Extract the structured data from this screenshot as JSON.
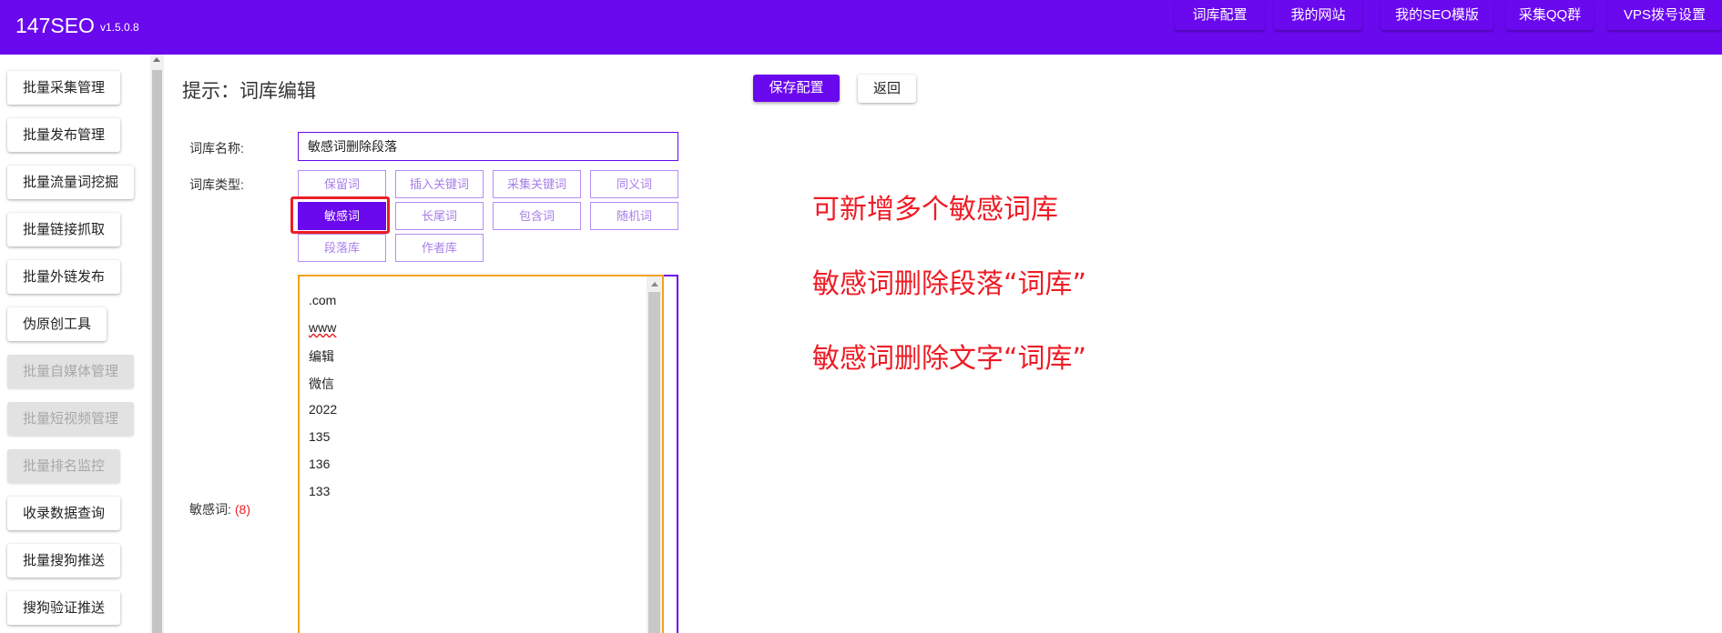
{
  "app": {
    "name": "147SEO",
    "version": "v1.5.0.8"
  },
  "topnav": [
    {
      "label": "词库配置"
    },
    {
      "label": "我的网站"
    },
    {
      "label": "我的SEO模版"
    },
    {
      "label": "采集QQ群"
    },
    {
      "label": "VPS拨号设置"
    }
  ],
  "sidebar": {
    "items": [
      {
        "label": "批量采集管理",
        "enabled": true
      },
      {
        "label": "批量发布管理",
        "enabled": true
      },
      {
        "label": "批量流量词挖掘",
        "enabled": true
      },
      {
        "label": "批量链接抓取",
        "enabled": true
      },
      {
        "label": "批量外链发布",
        "enabled": true
      },
      {
        "label": "伪原创工具",
        "enabled": true
      },
      {
        "label": "批量自媒体管理",
        "enabled": false
      },
      {
        "label": "批量短视频管理",
        "enabled": false
      },
      {
        "label": "批量排名监控",
        "enabled": false
      },
      {
        "label": "收录数据查询",
        "enabled": true
      },
      {
        "label": "批量搜狗推送",
        "enabled": true
      },
      {
        "label": "搜狗验证推送",
        "enabled": true
      }
    ]
  },
  "main": {
    "hint": "提示：词库编辑",
    "save_label": "保存配置",
    "back_label": "返回",
    "name_label": "词库名称:",
    "name_value": "敏感词删除段落",
    "type_label": "词库类型:",
    "types": [
      {
        "label": "保留词"
      },
      {
        "label": "插入关键词"
      },
      {
        "label": "采集关键词"
      },
      {
        "label": "同义词"
      },
      {
        "label": "敏感词",
        "selected": true
      },
      {
        "label": "长尾词"
      },
      {
        "label": "包含词"
      },
      {
        "label": "随机词"
      },
      {
        "label": "段落库"
      },
      {
        "label": "作者库"
      }
    ],
    "words_label": "敏感词:",
    "words_count": "(8)",
    "words": [
      ".com",
      "www",
      "编辑",
      "微信",
      "2022",
      "135",
      "136",
      "133"
    ]
  },
  "annotations": [
    "可新增多个敏感词库",
    "敏感词删除段落“词库”",
    "敏感词删除文字“词库”"
  ],
  "colors": {
    "brand": "#6a08ee",
    "highlight": "#ee1c25",
    "focus": "#f2a21b"
  }
}
